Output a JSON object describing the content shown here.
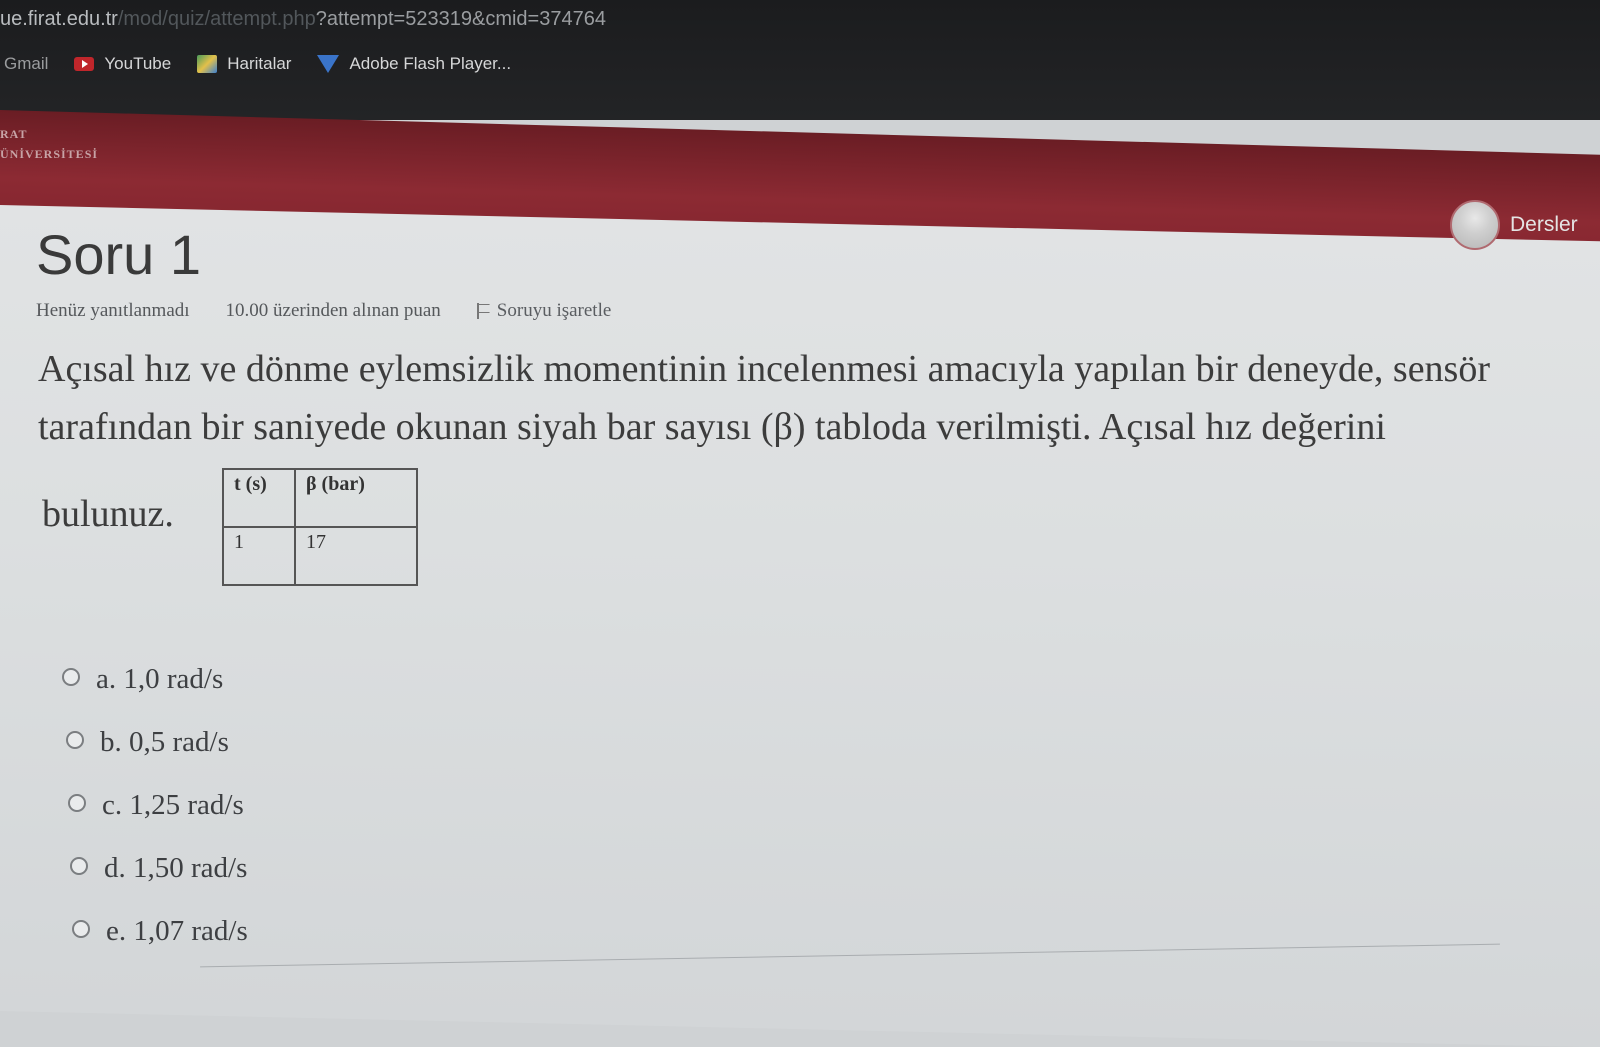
{
  "browser": {
    "url_host": "ue.firat.edu.tr",
    "url_path": "/mod/quiz/attempt.php",
    "url_query": "?attempt=523319&cmid=374764",
    "bookmarks": [
      {
        "label": "Gmail",
        "icon": "gmail-icon"
      },
      {
        "label": "YouTube",
        "icon": "youtube-icon"
      },
      {
        "label": "Haritalar",
        "icon": "maps-icon"
      },
      {
        "label": "Adobe Flash Player...",
        "icon": "flash-icon"
      }
    ]
  },
  "header": {
    "logo_line1": "RAT",
    "logo_line2": "ÜNİVERSİTESİ",
    "user_link": "Dersler"
  },
  "question": {
    "title": "Soru 1",
    "status": "Henüz yanıtlanmadı",
    "grade": "10.00 üzerinden alınan puan",
    "flag_label": "Soruyu işaretle",
    "text_line1": "Açısal hız ve dönme eylemsizlik momentinin incelenmesi amacıyla yapılan bir deneyde, sensör",
    "text_line2": "tarafından bir saniyede okunan siyah bar sayısı (β) tabloda verilmişti. Açısal hız değerini",
    "text_end": "bulunuz.",
    "table": {
      "headers": [
        "t (s)",
        "β (bar)"
      ],
      "rows": [
        [
          "1",
          "17"
        ]
      ]
    },
    "answers": [
      {
        "label": "a. 1,0 rad/s"
      },
      {
        "label": "b. 0,5 rad/s"
      },
      {
        "label": "c. 1,25 rad/s"
      },
      {
        "label": "d. 1,50 rad/s"
      },
      {
        "label": "e. 1,07 rad/s"
      }
    ]
  },
  "colors": {
    "header_red": "#8c2a33",
    "browser_dark": "#1b1c1e",
    "content_bg": "#dcdfe0"
  }
}
